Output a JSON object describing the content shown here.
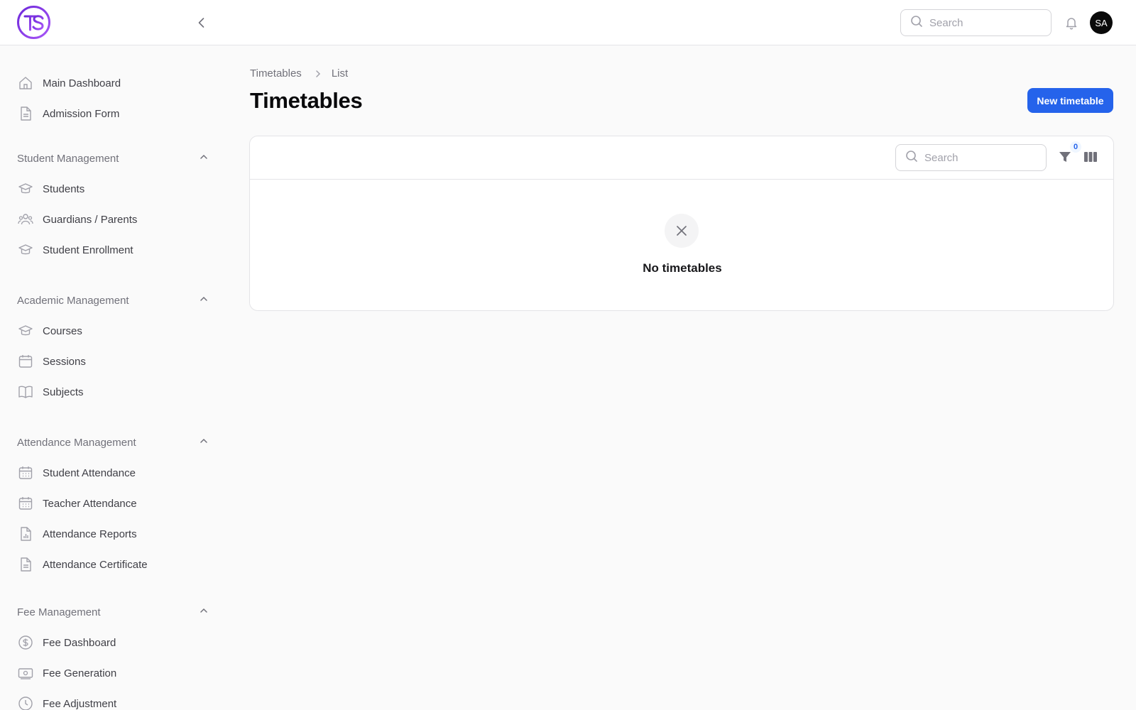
{
  "topbar": {
    "logo_text": "TS",
    "search_placeholder": "Search",
    "avatar_initials": "SA"
  },
  "sidebar": {
    "top_items": [
      {
        "label": "Main Dashboard",
        "icon": "home-icon"
      },
      {
        "label": "Admission Form",
        "icon": "document-icon"
      }
    ],
    "groups": [
      {
        "title": "Student Management",
        "items": [
          {
            "label": "Students",
            "icon": "graduation-cap-icon"
          },
          {
            "label": "Guardians / Parents",
            "icon": "users-icon"
          },
          {
            "label": "Student Enrollment",
            "icon": "graduation-cap-icon"
          }
        ]
      },
      {
        "title": "Academic Management",
        "items": [
          {
            "label": "Courses",
            "icon": "graduation-cap-icon"
          },
          {
            "label": "Sessions",
            "icon": "calendar-icon"
          },
          {
            "label": "Subjects",
            "icon": "book-icon"
          }
        ]
      },
      {
        "title": "Attendance Management",
        "items": [
          {
            "label": "Student Attendance",
            "icon": "calendar-days-icon"
          },
          {
            "label": "Teacher Attendance",
            "icon": "calendar-days-icon"
          },
          {
            "label": "Attendance Reports",
            "icon": "chart-document-icon"
          },
          {
            "label": "Attendance Certificate",
            "icon": "document-icon"
          }
        ]
      },
      {
        "title": "Fee Management",
        "items": [
          {
            "label": "Fee Dashboard",
            "icon": "dollar-circle-icon"
          },
          {
            "label": "Fee Generation",
            "icon": "banknote-icon"
          },
          {
            "label": "Fee Adjustment",
            "icon": "clock-icon"
          }
        ]
      }
    ]
  },
  "main": {
    "breadcrumb": [
      "Timetables",
      "List"
    ],
    "title": "Timetables",
    "new_button_label": "New timetable",
    "table": {
      "search_placeholder": "Search",
      "filter_count": "0",
      "empty_message": "No timetables"
    }
  },
  "colors": {
    "accent": "#2563eb",
    "logo_ring": "#7c3aed",
    "background": "#fafafa"
  }
}
